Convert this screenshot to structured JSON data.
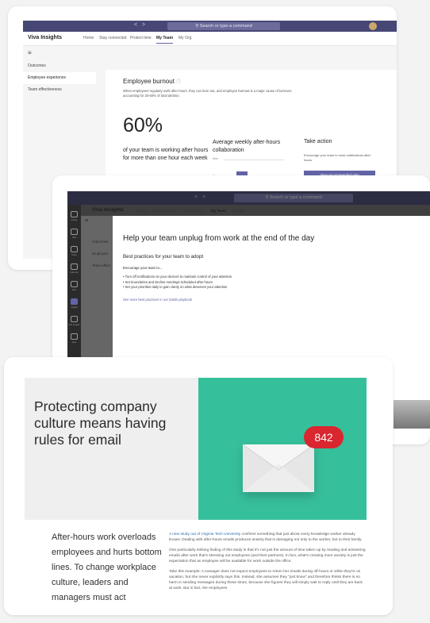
{
  "teams_main": {
    "nav_arrows": "< >",
    "search_placeholder": "Search or type a command",
    "app_name": "Viva Insights",
    "tabs": [
      "Home",
      "Stay connected",
      "Protect time",
      "My Team",
      "My Org"
    ],
    "active_tab_index": 3,
    "left_nav": [
      "Outcomes",
      "Employee experience",
      "Team effectiveness"
    ],
    "selected_nav_index": 1,
    "panel": {
      "title": "Employee burnout",
      "description": "When employees regularly work after hours, they can burn out, and employee burnout is a major cause of turnover, accounting for 20-50% of total attrition.",
      "stat_value": "60%",
      "stat_text": "of your team is working after hours for more than one hour each week",
      "chart_title": "Average weekly after-hours collaboration",
      "chart_ticks": [
        "6hrs",
        "3hrs"
      ],
      "take_action_title": "Take action",
      "take_action_desc": "Encourage your team to mute notifications after hours.",
      "take_action_button": "View recommended plan"
    }
  },
  "teams_dialog": {
    "nav_arrows": "< >",
    "search_placeholder": "Search or type a command",
    "app_name": "Viva Insights",
    "tabs": [
      "Home",
      "Stay connected",
      "Protect time",
      "My Team",
      "My Org"
    ],
    "rail_labels": [
      "Activity",
      "Chat",
      "Teams",
      "Calendar",
      "Files",
      "Insights",
      "Viva Insights",
      "Apps"
    ],
    "left_nav": [
      "Outcomes",
      "Employee",
      "Team effect"
    ],
    "title": "Help your team unplug from work at the end of the day",
    "subtitle": "Best practices for your team to adopt",
    "encourage": "Encourage your team to...",
    "tips": [
      "Turn off notifications on your devices to maintain control of your attention",
      "Set boundaries and decline meetings scheduled after hours",
      "Set your priorities daily to gain clarity on what deserves your attention"
    ],
    "link": "See more best practices in our habits playbook"
  },
  "article": {
    "hero_title": "Protecting company culture means having rules for email",
    "badge": "842",
    "lead": "After-hours work overloads employees and hurts bottom lines. To change workplace culture, leaders and managers must act",
    "link_text": "A new study out of Virginia Tech University",
    "p1": "confirms something that just about every knowledge worker already knows: Dealing with after-hours emails produces anxiety that is damaging not only to the worker, but to their family.",
    "p2": "One particularly striking finding of this study is that it's not just the amount of time taken up by reading and answering emails after work that's stressing out employees (and their partners). In fact, what's creating more anxiety is just the expectation that an employee will be available for work outside the office.",
    "p3": "Take this example: A manager does not expect employees to return her emails during off-hours or while they're on vacation, but she never explicitly says this. Instead, she assumes they \"just know\" and therefore thinks there is no harm in sending messages during these times, because she figures they will simply wait to reply until they are back at work. But in fact, the employees"
  }
}
